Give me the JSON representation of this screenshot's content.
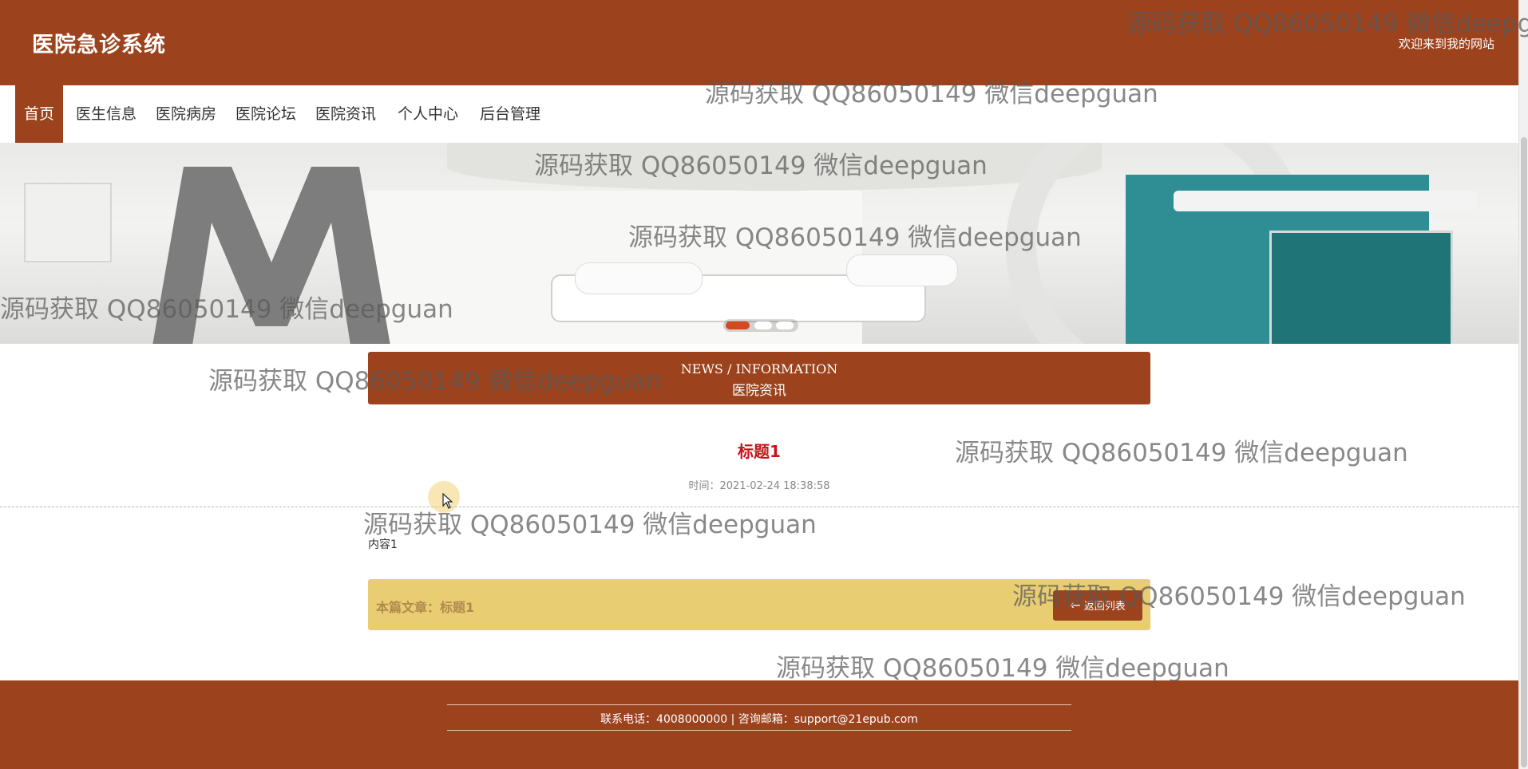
{
  "header": {
    "site_title": "医院急诊系统",
    "welcome": "欢迎来到我的网站"
  },
  "nav": {
    "items": [
      {
        "label": "首页",
        "active": true
      },
      {
        "label": "医生信息"
      },
      {
        "label": "医院病房"
      },
      {
        "label": "医院论坛"
      },
      {
        "label": "医院资讯"
      },
      {
        "label": "个人中心"
      },
      {
        "label": "后台管理"
      }
    ]
  },
  "banner": {
    "slide_count": 3,
    "active_slide": 1
  },
  "section": {
    "title_en": "NEWS / INFORMATION",
    "title_cn": "医院资讯"
  },
  "article": {
    "title": "标题1",
    "time": "时间：2021-02-24 18:38:58",
    "content": "内容1",
    "current_label": "本篇文章：标题1",
    "back_label": "返回列表"
  },
  "footer": {
    "contact": "联系电话：4008000000 | 咨询邮箱：support@21epub.com"
  },
  "watermark": {
    "text": "源码获取 QQ86050149 微信deepguan"
  },
  "colors": {
    "brand": "#9c421d",
    "accent_title": "#c4141a",
    "bar": "#e9cd72",
    "dot_active": "#d34a1f"
  }
}
